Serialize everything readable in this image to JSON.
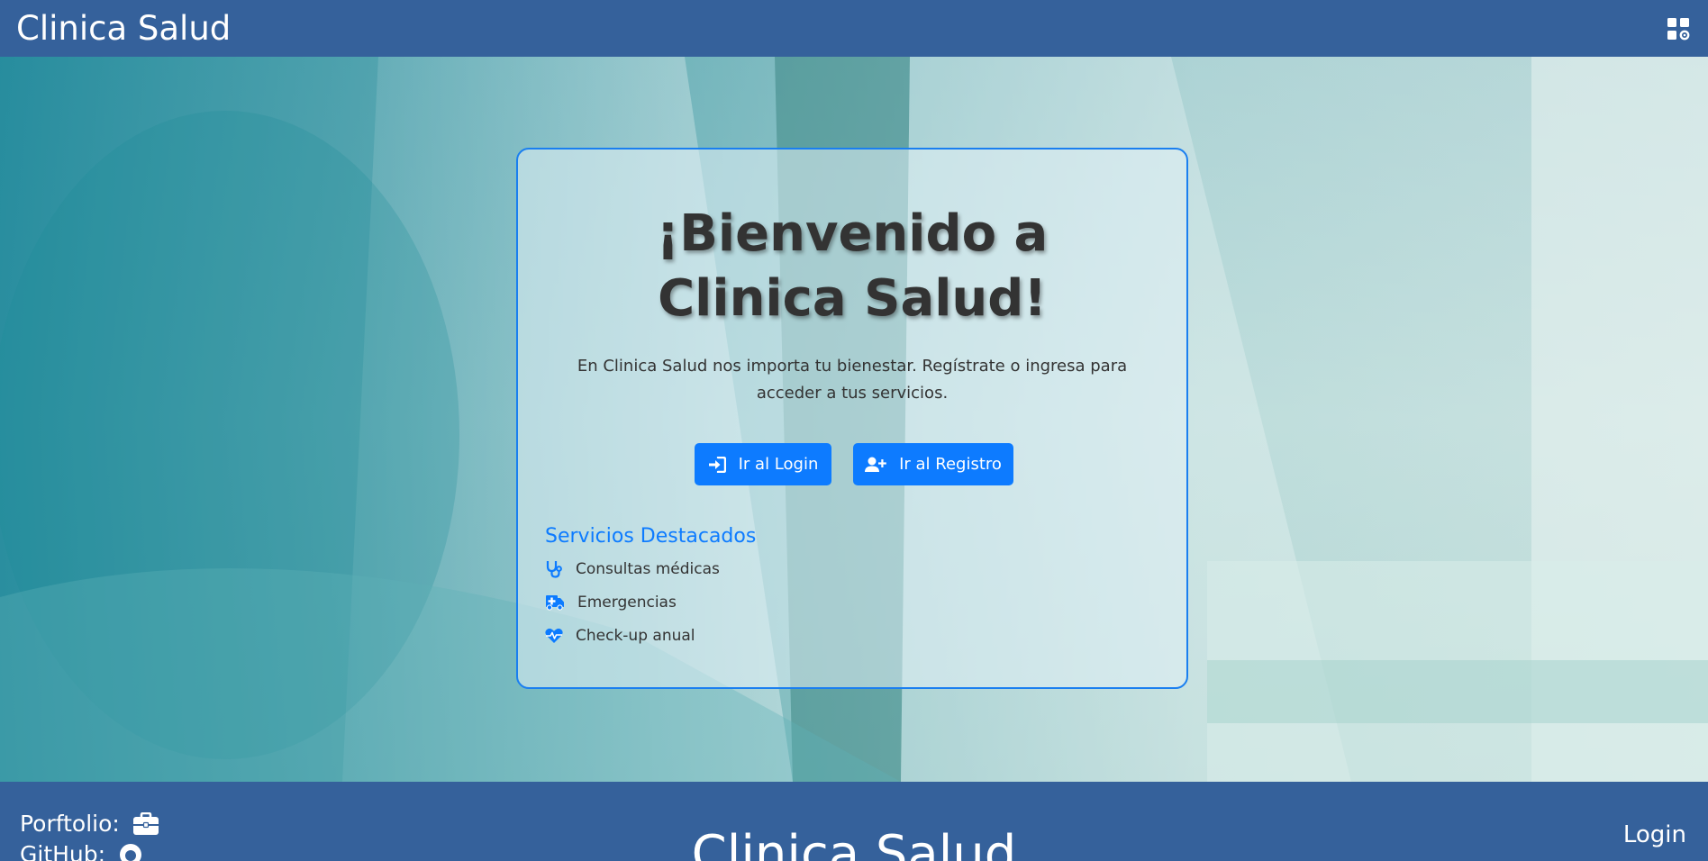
{
  "navbar": {
    "brand": "Clinica Salud",
    "apps_icon": "apps-grid-gear-icon"
  },
  "hero": {
    "title": "¡Bienvenido a Clinica Salud!",
    "lead": "En Clinica Salud nos importa tu bienestar. Regístrate o ingresa para acceder a tus servicios.",
    "buttons": {
      "login": {
        "label": "Ir al Login",
        "icon": "sign-in-icon"
      },
      "registro": {
        "label": "Ir al Registro",
        "icon": "user-plus-icon"
      }
    },
    "services": {
      "title": "Servicios Destacados",
      "items": [
        {
          "label": "Consultas médicas",
          "icon": "stethoscope-icon"
        },
        {
          "label": "Emergencias",
          "icon": "ambulance-icon"
        },
        {
          "label": "Check-up anual",
          "icon": "heartbeat-icon"
        }
      ]
    }
  },
  "footer": {
    "portfolio_label": "Porftolio:",
    "github_label": "GitHub:",
    "title": "Clinica Salud",
    "login_label": "Login"
  },
  "colors": {
    "navbar": "#35619b",
    "accent": "#0d7bff",
    "card_border": "#1a7ff0"
  }
}
